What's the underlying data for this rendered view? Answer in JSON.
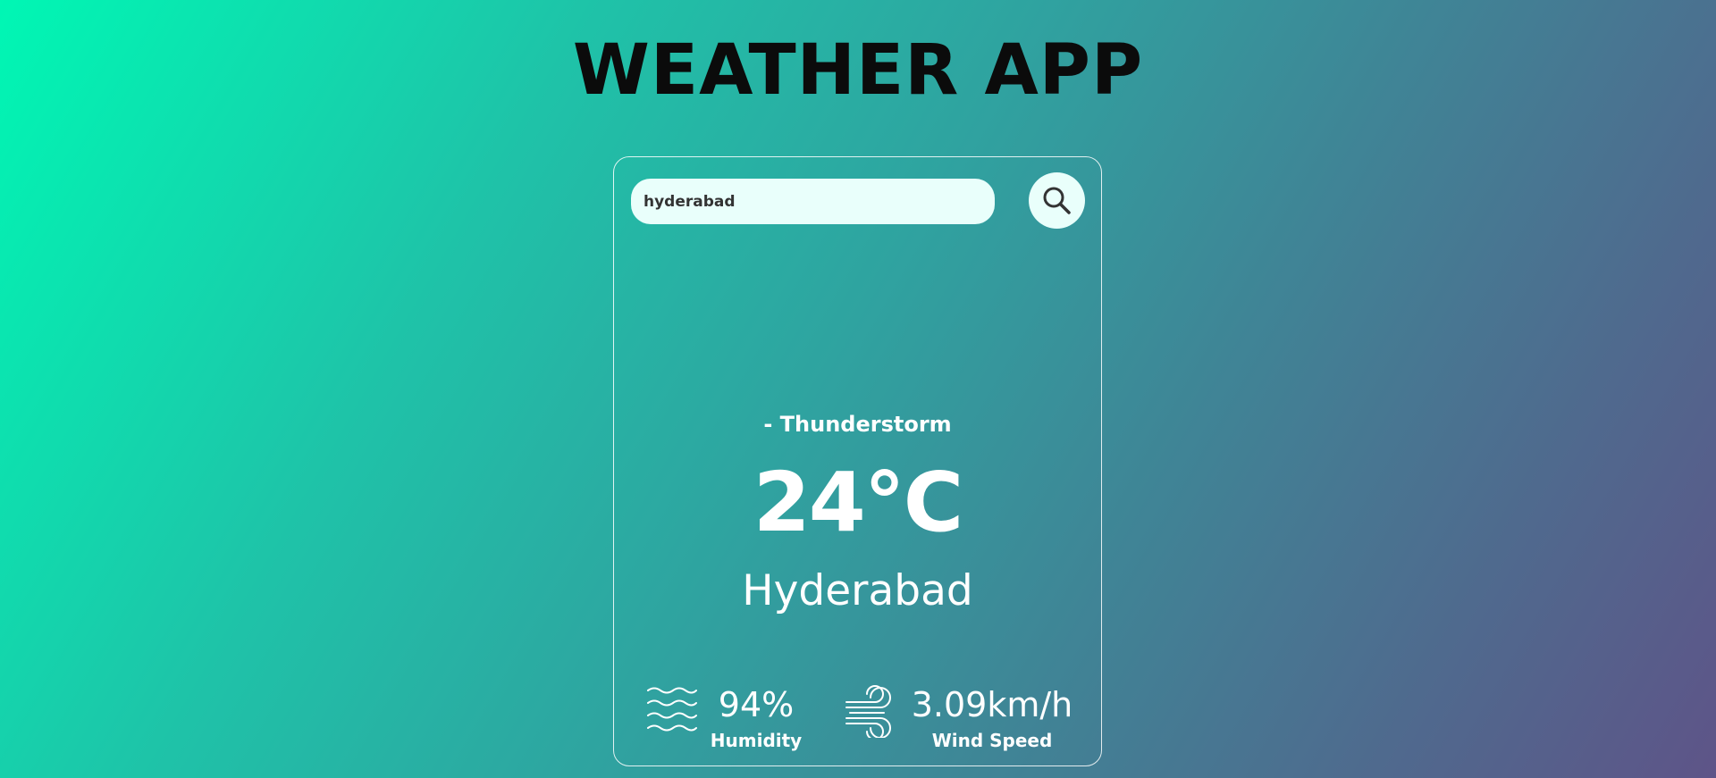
{
  "app": {
    "title": "WEATHER APP"
  },
  "search": {
    "value": "hyderabad",
    "button_icon": "search-icon"
  },
  "weather": {
    "condition": "- Thunderstorm",
    "temperature": "24°C",
    "city": "Hyderabad"
  },
  "stats": {
    "humidity": {
      "icon": "humidity-waves-icon",
      "value": "94%",
      "label": "Humidity"
    },
    "wind": {
      "icon": "wind-icon",
      "value": "3.09km/h",
      "label": "Wind Speed"
    }
  },
  "colors": {
    "gradient_start": "#00f7b4",
    "gradient_end": "#5e5488",
    "input_background": "#e9fffb",
    "title_text": "#0b0b0b",
    "card_text": "#ffffff"
  }
}
